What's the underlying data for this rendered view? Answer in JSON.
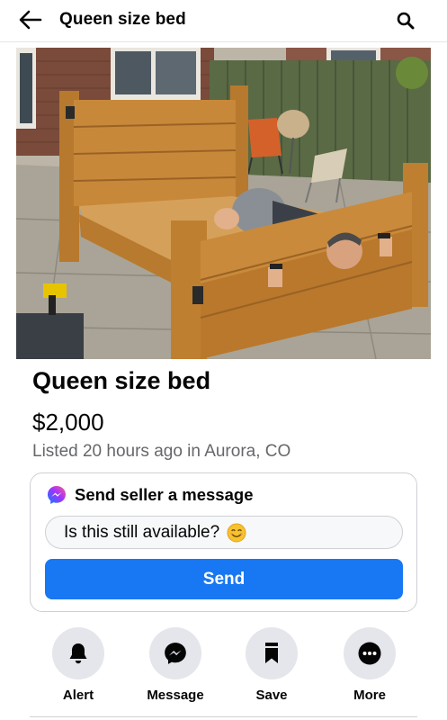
{
  "header": {
    "title": "Queen size bed",
    "back_icon": "back-arrow-icon",
    "search_icon": "search-icon"
  },
  "listing": {
    "title": "Queen size bed",
    "price": "$2,000",
    "listed_text": "Listed 20 hours ago in Aurora, CO"
  },
  "message_card": {
    "heading": "Send seller a message",
    "input_value": "Is this still available?",
    "send_label": "Send",
    "accent_color": "#1877f2"
  },
  "actions": [
    {
      "label": "Alert",
      "icon": "bell-icon"
    },
    {
      "label": "Message",
      "icon": "messenger-icon"
    },
    {
      "label": "Save",
      "icon": "bookmark-icon"
    },
    {
      "label": "More",
      "icon": "more-dots-icon"
    }
  ]
}
